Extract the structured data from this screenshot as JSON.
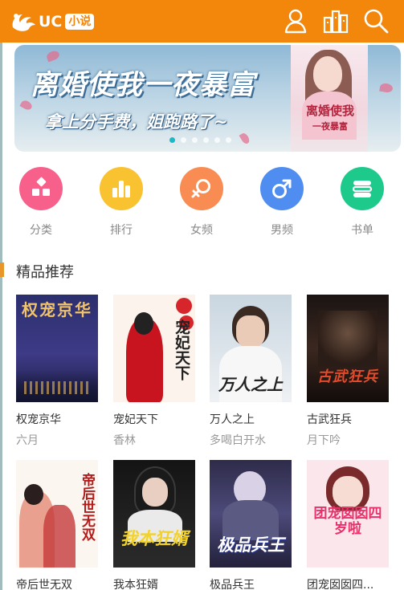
{
  "header": {
    "logo_text": "UC",
    "logo_tag": "小说",
    "icons": [
      "user-icon",
      "bookshelf-icon",
      "search-icon"
    ],
    "background": "#f2870c"
  },
  "banner": {
    "title": "离婚使我一夜暴富",
    "subtitle": "拿上分手费，姐跑路了~",
    "cover_title": "离婚使我",
    "cover_subtitle": "一夜暴富",
    "slide_count": 6,
    "active_slide": 1
  },
  "categories": [
    {
      "label": "分类",
      "icon": "grid-icon",
      "color": "#f6608a"
    },
    {
      "label": "排行",
      "icon": "bar-chart-icon",
      "color": "#f8c231"
    },
    {
      "label": "女频",
      "icon": "female-icon",
      "color": "#f98c52"
    },
    {
      "label": "男频",
      "icon": "male-icon",
      "color": "#4f8ef0"
    },
    {
      "label": "书单",
      "icon": "booklist-icon",
      "color": "#1ec98c"
    }
  ],
  "section": {
    "title": "精品推荐",
    "accent": "#e8962a"
  },
  "books": [
    {
      "title": "权宠京华",
      "author": "六月",
      "cover_text": "权宠京华"
    },
    {
      "title": "宠妃天下",
      "author": "香林",
      "cover_text": "宠妃天下"
    },
    {
      "title": "万人之上",
      "author": "多喝白开水",
      "cover_text": "万人之上"
    },
    {
      "title": "古武狂兵",
      "author": "月下吟",
      "cover_text": "古武狂兵"
    },
    {
      "title": "帝后世无双",
      "author": "",
      "cover_text": "帝后世无双"
    },
    {
      "title": "我本狂婿",
      "author": "",
      "cover_text": "我本狂婿"
    },
    {
      "title": "极品兵王",
      "author": "",
      "cover_text": "极品兵王"
    },
    {
      "title": "团宠囡囡四...",
      "author": "",
      "cover_text": "团宠囡囡四岁啦"
    }
  ]
}
